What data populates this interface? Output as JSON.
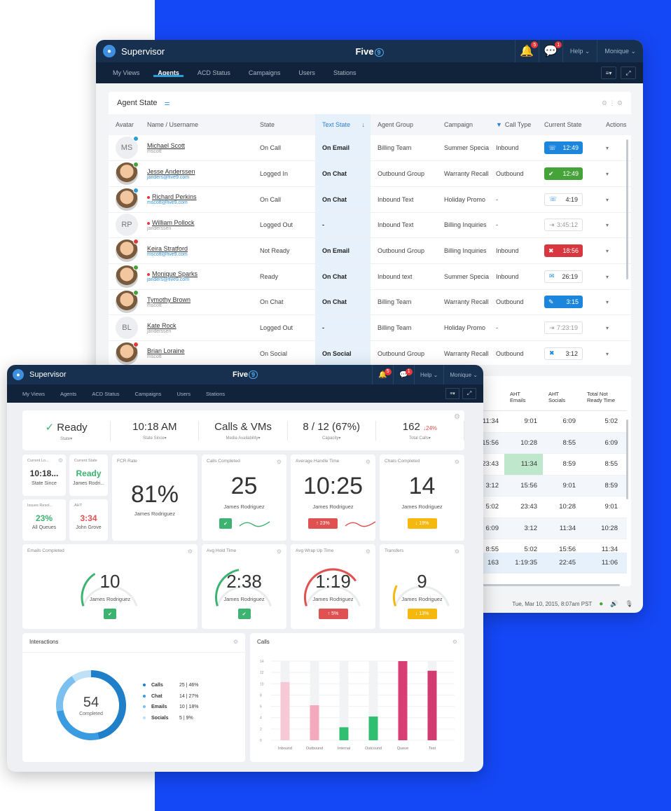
{
  "back_window": {
    "title": "Supervisor",
    "logo": "Five",
    "logo_sup": "9",
    "bell_badge": "5",
    "chat_badge": "1",
    "help": "Help",
    "user": "Monique",
    "nav": [
      "My Views",
      "Agents",
      "ACD Status",
      "Campaigns",
      "Users",
      "Stations"
    ],
    "active_nav": "Agents",
    "agent_state": {
      "title": "Agent State",
      "columns": [
        "Avatar",
        "Name / Username",
        "State",
        "Text State",
        "Agent Group",
        "Campaign",
        "Call Type",
        "Current State",
        "Actions"
      ],
      "rows": [
        {
          "initials": "MS",
          "name": "Michael Scott",
          "user": "mscott",
          "state": "On Call",
          "text": "On Email",
          "group": "Billing Team",
          "campaign": "Summer Special 20...",
          "type": "Inbound",
          "time": "12:49",
          "style": "blue",
          "icon": "phone-icon",
          "glyph": "☏",
          "dot": "#2d9cdb",
          "photo": false,
          "redmark": false,
          "mail": false
        },
        {
          "initials": "",
          "name": "Jesse Anderssen",
          "user": "janders@five9.com",
          "state": "Logged In",
          "text": "On Chat",
          "group": "Outbound Group",
          "campaign": "Warranty Recall",
          "type": "Outbound",
          "time": "12:49",
          "style": "green",
          "icon": "check-icon",
          "glyph": "✔",
          "dot": "#46a33a",
          "photo": true,
          "redmark": false,
          "mail": true
        },
        {
          "initials": "",
          "name": "Richard Perkins",
          "user": "mscott@five9.com",
          "state": "On Call",
          "text": "On Chat",
          "group": "Inbound Text",
          "campaign": "Holiday Promo",
          "type": "-",
          "time": "4:19",
          "style": "outline",
          "icon": "phone-icon",
          "glyph": "☏",
          "dot": "#2d9cdb",
          "photo": true,
          "redmark": true,
          "mail": true
        },
        {
          "initials": "RP",
          "name": "William Pollock",
          "user": "janderssen",
          "state": "Logged Out",
          "text": "-",
          "group": "Inbound Text",
          "campaign": "Billing Inquiries",
          "type": "-",
          "time": "3:45:12",
          "style": "gray",
          "icon": "logout-icon",
          "glyph": "⇥",
          "dot": "",
          "photo": false,
          "redmark": true,
          "mail": false
        },
        {
          "initials": "",
          "name": "Keira Stratford",
          "user": "mscott@five9.com",
          "state": "Not Ready",
          "text": "On Email",
          "group": "Outbound Group",
          "campaign": "Billing Inquiries",
          "type": "Inbound",
          "time": "18:56",
          "style": "red",
          "icon": "not-ready-icon",
          "glyph": "✖",
          "dot": "#e5383b",
          "photo": true,
          "redmark": false,
          "mail": true
        },
        {
          "initials": "",
          "name": "Monique Sparks",
          "user": "janders@five9.com",
          "state": "Ready",
          "text": "On Chat",
          "group": "Inbound text",
          "campaign": "Summer Special 20...",
          "type": "Inbound",
          "time": "26:19",
          "style": "outline",
          "icon": "mail-icon",
          "glyph": "✉",
          "dot": "#46a33a",
          "photo": true,
          "redmark": true,
          "mail": true
        },
        {
          "initials": "",
          "name": "Tymothy Brown",
          "user": "mscott",
          "state": "On Chat",
          "text": "On Chat",
          "group": "Billing Team",
          "campaign": "Warranty Recall",
          "type": "Outbound",
          "time": "3:15",
          "style": "blue",
          "icon": "chat-icon",
          "glyph": "✎",
          "dot": "#46a33a",
          "photo": true,
          "redmark": false,
          "mail": false
        },
        {
          "initials": "BL",
          "name": "Kate Rock",
          "user": "janderssen",
          "state": "Logged Out",
          "text": "-",
          "group": "Billing Team",
          "campaign": "Holiday Promo",
          "type": "-",
          "time": "7:23:19",
          "style": "gray",
          "icon": "logout-icon",
          "glyph": "⇥",
          "dot": "",
          "photo": false,
          "redmark": false,
          "mail": false
        },
        {
          "initials": "",
          "name": "Brian Loraine",
          "user": "mscott",
          "state": "On Social",
          "text": "On Social",
          "group": "Outbound Group",
          "campaign": "Warranty Recall",
          "type": "Outbound",
          "time": "3:12",
          "style": "outline",
          "icon": "not-ready-icon",
          "glyph": "✖",
          "dot": "#e5383b",
          "photo": true,
          "redmark": false,
          "mail": false
        }
      ]
    },
    "stats": {
      "headers": [
        "AHT\nEmails",
        "AHT\nSocials",
        "Total Not\nReady Time"
      ],
      "rows": [
        [
          "11:34",
          "9:01",
          "6:09",
          "5:02"
        ],
        [
          "15:56",
          "10:28",
          "8:55",
          "6:09"
        ],
        [
          "23:43",
          "11:34",
          "8:59",
          "8:55"
        ],
        [
          "3:12",
          "15:56",
          "9:01",
          "8:59"
        ],
        [
          "5:02",
          "23:43",
          "10:28",
          "9:01"
        ],
        [
          "6:09",
          "3:12",
          "11:34",
          "10:28"
        ],
        [
          "8:55",
          "5:02",
          "15:56",
          "11:34"
        ]
      ],
      "total": [
        "163",
        "1:19:35",
        "22:45",
        "11:06"
      ],
      "footer": "Tue, Mar 10, 2015, 8:07am PST"
    }
  },
  "front_window": {
    "title": "Supervisor",
    "logo": "Five",
    "logo_sup": "9",
    "help": "Help",
    "user": "Monique",
    "nav": [
      "My Views",
      "Agents",
      "ACD Status",
      "Campaigns",
      "Users",
      "Stations"
    ],
    "kpis": [
      {
        "value": "Ready",
        "label": "State"
      },
      {
        "value": "10:18 AM",
        "label": "State Since"
      },
      {
        "value": "Calls & VMs",
        "label": "Media Availability"
      },
      {
        "value": "8 / 12 (67%)",
        "label": "Capacity"
      },
      {
        "value": "162",
        "delta": "24%",
        "label": "Total Calls"
      }
    ],
    "small_tiles": [
      {
        "title": "Current Lo...",
        "value": "10:18...",
        "sub": "State Since"
      },
      {
        "title": "Current State",
        "value": "Ready",
        "sub": "James Rodri..."
      },
      {
        "title": "Issues Resol...",
        "value": "23%",
        "sub": "All Queues"
      },
      {
        "title": "AHT",
        "value": "3:34",
        "sub": "John Grove"
      }
    ],
    "fcr": {
      "title": "FCR Rate",
      "value": "81%",
      "sub": "James Rodriguez"
    },
    "tiles_row1": [
      {
        "title": "Calls Completed",
        "value": "25",
        "sub": "James Rodriguez",
        "badge": "",
        "badge_style": "g",
        "spark": "#3cb371"
      },
      {
        "title": "Average Handle Time",
        "value": "10:25",
        "sub": "James Rodriguez",
        "badge": "23%",
        "badge_style": "r",
        "spark": "#e05252"
      },
      {
        "title": "Chats Completed",
        "value": "14",
        "sub": "James Rodriguez",
        "badge": "19%",
        "badge_style": "y",
        "spark": ""
      }
    ],
    "tiles_row2": [
      {
        "title": "Emails Completed",
        "value": "10",
        "sub": "James Rodriguez",
        "badge": "",
        "badge_style": "g",
        "gauge": "#3cb371",
        "level": 0.35
      },
      {
        "title": "Avg Hold Time",
        "value": "2:38",
        "sub": "James Rodriguez",
        "badge": "",
        "badge_style": "g",
        "gauge": "#3cb371",
        "level": 0.45
      },
      {
        "title": "Avg Wrap Up Time",
        "value": "1:19",
        "sub": "James Rodriguez",
        "badge": "5%",
        "badge_style": "r",
        "gauge": "#e05252",
        "level": 0.75
      },
      {
        "title": "Transfers",
        "value": "9",
        "sub": "James Rodriguez",
        "badge": "13%",
        "badge_style": "y",
        "gauge": "#f5b80f",
        "level": 0.2
      }
    ],
    "interactions": {
      "title": "Interactions",
      "total": "54",
      "total_label": "Completed",
      "legend": [
        {
          "label": "Calls",
          "value": "25 | 46%",
          "color": "#1f7fc9"
        },
        {
          "label": "Chat",
          "value": "14 | 27%",
          "color": "#3a9be0"
        },
        {
          "label": "Emails",
          "value": "10 | 18%",
          "color": "#7cc0ef"
        },
        {
          "label": "Socials",
          "value": "5 | 9%",
          "color": "#bfe0f7"
        }
      ]
    },
    "calls_chart_title": "Calls"
  },
  "chart_data": {
    "type": "bar",
    "title": "Calls",
    "categories": [
      "Inbound",
      "Outbound",
      "Internal",
      "Outcound",
      "Queue",
      "Test"
    ],
    "values": [
      10.3,
      6.2,
      2.3,
      4.2,
      14,
      12.3
    ],
    "colors": [
      "#f6c9d6",
      "#f4a9bd",
      "#2fbf71",
      "#2fbf71",
      "#d83e74",
      "#d13b6f"
    ],
    "ytick_labels": [
      "14",
      "12",
      "10",
      "8",
      "6",
      "4",
      "2",
      "0"
    ],
    "ylim": [
      0,
      14
    ]
  }
}
